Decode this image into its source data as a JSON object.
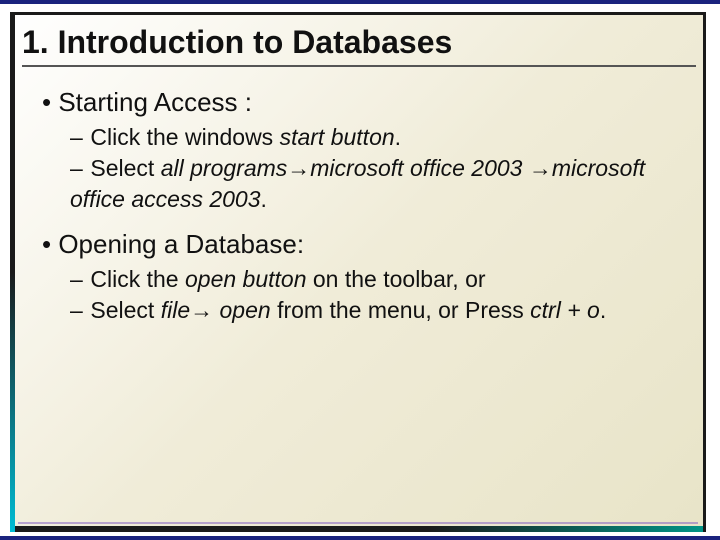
{
  "title": "1. Introduction to Databases",
  "bullets": {
    "b1": {
      "text": "Starting Access :",
      "sub": {
        "s1": {
          "pre": "Click the windows ",
          "it1": "start button",
          "post": "."
        },
        "s2": {
          "pre": "Select ",
          "it1": "all programs",
          "arr1": "→",
          "it2": "microsoft office 2003",
          "arr2": "→",
          "it3": "microsoft office access 2003",
          "post": "."
        }
      }
    },
    "b2": {
      "text": "Opening a Database:",
      "sub": {
        "s1": {
          "pre": "Click the ",
          "it1": "open button",
          "post": " on the toolbar, or"
        },
        "s2": {
          "pre": "Select ",
          "it1": "file",
          "arr1": "→",
          "sp1": " ",
          "it2": "open",
          "mid": " from the menu, or Press ",
          "it3": "ctrl + o",
          "post": "."
        }
      }
    }
  },
  "dash": "–"
}
